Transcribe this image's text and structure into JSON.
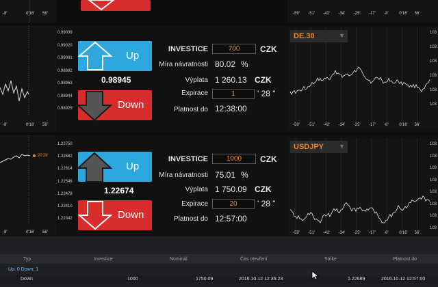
{
  "top_strip": {
    "axis_labels_left": [
      "-8'",
      "0'16'",
      "56'"
    ],
    "axis_labels_right": [
      "-59'",
      "-51'",
      "-42'",
      "-34'",
      "-25'",
      "-17'",
      "-8'",
      "0'16'",
      "56'"
    ]
  },
  "panels": [
    {
      "price_ticks": [
        "0.99039",
        "0.99020",
        "0.99001",
        "0.98982",
        "0.98963",
        "0.98944",
        "0.98925"
      ],
      "bottom_axis": [
        "-8'",
        "0'16'",
        "56'"
      ],
      "buttons": {
        "up_label": "Up",
        "down_label": "Down"
      },
      "up_active": true,
      "down_active": false,
      "current_price": "0.98945",
      "labels": {
        "investice": "INVESTICE",
        "mira": "Míra návratnosti",
        "vyplata": "Výplata",
        "expirace": "Expirace",
        "platnost": "Platnost do"
      },
      "investice_value": "700",
      "currency": "CZK",
      "mira_value": "80.02",
      "percent": "%",
      "vyplata_value": "1 260.13",
      "vyplata_currency": "CZK",
      "expirace_minutes": "1",
      "expirace_seconds": "' 28 \"",
      "platnost_value": "12:38:00",
      "instrument": "DE.30",
      "right_axis": [
        "-59'",
        "-51'",
        "-42'",
        "-34'",
        "-25'",
        "-17'",
        "-8'",
        "0'16'",
        "56'"
      ]
    },
    {
      "price_ticks": [
        "1.22750",
        "1.22682",
        "1.22614",
        "1.22546",
        "1.22478",
        "1.22410",
        "1.22342"
      ],
      "bottom_axis": [
        "-8'",
        "0'16'",
        "56'"
      ],
      "marker_label": "20'28'",
      "buttons": {
        "up_label": "Up",
        "down_label": "Down"
      },
      "up_active": false,
      "down_active": true,
      "current_price": "1.22674",
      "labels": {
        "investice": "INVESTICE",
        "mira": "Míra návratnosti",
        "vyplata": "Výplata",
        "expirace": "Expirace",
        "platnost": "Platnost do"
      },
      "investice_value": "1000",
      "currency": "CZK",
      "mira_value": "75.01",
      "percent": "%",
      "vyplata_value": "1 750.09",
      "vyplata_currency": "CZK",
      "expirace_minutes": "20",
      "expirace_seconds": "' 28 \"",
      "platnost_value": "12:57:00",
      "instrument": "USDJPY",
      "right_axis": [
        "-59'",
        "-51'",
        "-42'",
        "-34'",
        "-25'",
        "-17'",
        "-8'",
        "0'16'",
        "56'"
      ],
      "right_ticks": [
        "103",
        "103",
        "103",
        "103",
        "103",
        "103",
        "103",
        "103"
      ]
    }
  ],
  "right_ticks_top": [
    "103",
    "103",
    "103",
    "103",
    "103",
    "103"
  ],
  "table": {
    "headers": [
      "Typ",
      "Investice",
      "Nominál",
      "Čas otevření",
      "Strike",
      "Platnost do"
    ],
    "summary": "Up: 0 Down: 1",
    "row": [
      "Down",
      "1000",
      "1750.09",
      "2016.10.12 12:36:23",
      "1.22689",
      "2016.10.12 12:57:00"
    ]
  }
}
